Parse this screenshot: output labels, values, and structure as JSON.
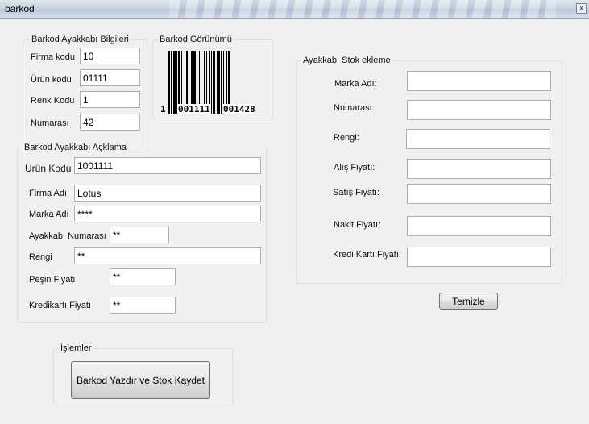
{
  "window": {
    "title": "barkod",
    "close_glyph": "x"
  },
  "group_info": {
    "legend": "Barkod Ayakkabı Bilgileri",
    "firma_label": "Firma kodu",
    "firma_value": "10",
    "urun_label": "Ürün kodu",
    "urun_value": "01111",
    "renk_label": "Renk Kodu",
    "renk_value": "1",
    "numara_label": "Numarası",
    "numara_value": "42"
  },
  "group_barcode": {
    "legend": "Barkod Görünümü",
    "digit_left": "1",
    "digits_mid": "001111",
    "digits_right": "001428"
  },
  "group_desc": {
    "legend": "Barkod Ayakkabı Açklama",
    "urun_kodu_label": "Ürün Kodu",
    "urun_kodu_value": "1001111",
    "firma_adi_label": "Firma Adı",
    "firma_adi_value": "Lotus",
    "marka_adi_label": "Marka Adı",
    "marka_adi_value": "****",
    "numara_label": "Ayakkabı Numarası",
    "numara_value": "**",
    "rengi_label": "Rengi",
    "rengi_value": "**",
    "pesin_label": "Peşin Fiyatı",
    "pesin_value": "**",
    "kredi_label": "Kredikartı Fiyatı",
    "kredi_value": "**"
  },
  "group_stock": {
    "legend": "Ayakkabı Stok ekleme",
    "marka_label": "Marka Adı:",
    "numarasi_label": "Numarası:",
    "rengi_label": "Rengi:",
    "alis_label": "Alış Fiyatı:",
    "satis_label": "Satış Fiyatı:",
    "nakit_label": "Nakit Fiyatı:",
    "kredi_label": "Kredi Kartı Fiyatı:"
  },
  "clear_button": "Temizle",
  "group_actions": {
    "legend": "İşlemler",
    "print_button": "Barkod Yazdır ve Stok Kaydet"
  },
  "colors": {
    "window_bg": "#f0f0f0",
    "group_border": "#d5dfe5",
    "input_border": "#abadb3"
  }
}
